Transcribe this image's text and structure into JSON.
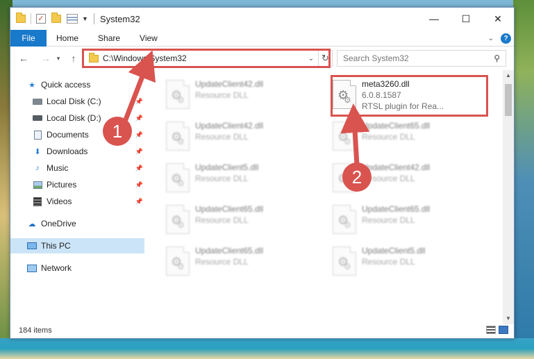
{
  "window": {
    "title": "System32",
    "minimize": "—",
    "maximize": "☐",
    "close": "✕"
  },
  "ribbon": {
    "file": "File",
    "tabs": [
      "Home",
      "Share",
      "View"
    ],
    "help": "?"
  },
  "address": {
    "path": "C:\\Windows\\System32",
    "search_placeholder": "Search System32"
  },
  "nav": {
    "items": [
      {
        "label": "Quick access",
        "icon": "star-icon",
        "pinned": false
      },
      {
        "label": "Local Disk (C:)",
        "icon": "drive-icon",
        "pinned": true
      },
      {
        "label": "Local Disk (D:)",
        "icon": "drive-icon",
        "pinned": true
      },
      {
        "label": "Documents",
        "icon": "documents-icon",
        "pinned": true
      },
      {
        "label": "Downloads",
        "icon": "downloads-icon",
        "pinned": true
      },
      {
        "label": "Music",
        "icon": "music-icon",
        "pinned": true
      },
      {
        "label": "Pictures",
        "icon": "pictures-icon",
        "pinned": true
      },
      {
        "label": "Videos",
        "icon": "videos-icon",
        "pinned": true
      },
      {
        "label": "OneDrive",
        "icon": "onedrive-icon",
        "pinned": false
      },
      {
        "label": "This PC",
        "icon": "this-pc-icon",
        "pinned": false
      },
      {
        "label": "Network",
        "icon": "network-icon",
        "pinned": false
      }
    ]
  },
  "files": {
    "highlighted": {
      "name": "meta3260.dll",
      "version": "6.0.8.1587",
      "description": "RTSL plugin for Rea..."
    },
    "left_column": [
      {
        "name": "UpdateClient42.dll",
        "type": "Resource DLL"
      },
      {
        "name": "UpdateClient42.dll",
        "type": "Resource DLL"
      },
      {
        "name": "UpdateClient5.dll",
        "type": "Resource DLL"
      },
      {
        "name": "UpdateClient65.dll",
        "type": "Resource DLL"
      },
      {
        "name": "UpdateClient65.dll",
        "type": "Resource DLL"
      }
    ],
    "right_column": [
      {
        "name": "UpdateClient65.dll",
        "type": "Resource DLL"
      },
      {
        "name": "UpdateClient42.dll",
        "type": "Resource DLL"
      },
      {
        "name": "UpdateClient65.dll",
        "type": "Resource DLL"
      },
      {
        "name": "UpdateClient5.dll",
        "type": "Resource DLL"
      }
    ]
  },
  "status": {
    "item_count": "184 items"
  },
  "annotations": {
    "step1": "1",
    "step2": "2",
    "color": "#d9534f"
  }
}
